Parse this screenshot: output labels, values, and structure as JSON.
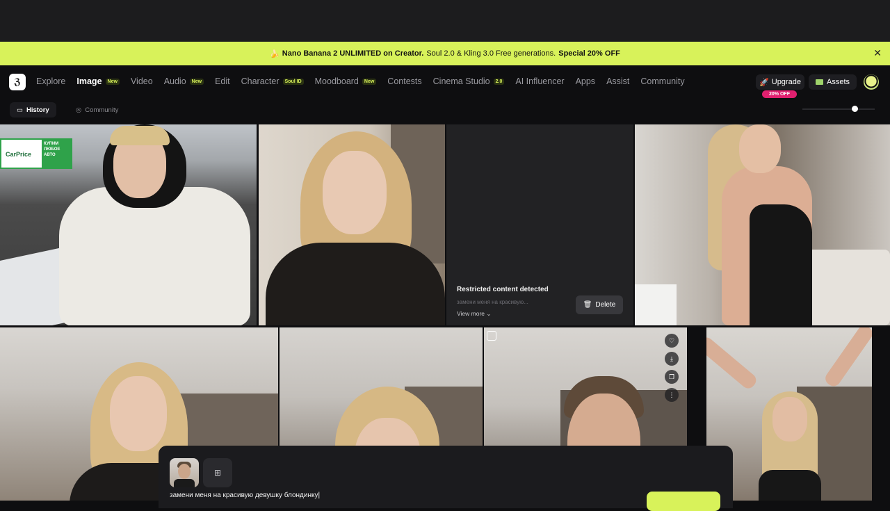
{
  "promo": {
    "emoji": "🍌",
    "bold1": "Nano Banana 2 UNLIMITED on Creator.",
    "text": "Soul 2.0 & Kling 3.0 Free generations.",
    "bold2": "Special 20% OFF",
    "close": "✕"
  },
  "nav": {
    "items": [
      {
        "label": "Explore",
        "badge": ""
      },
      {
        "label": "Image",
        "badge": "New"
      },
      {
        "label": "Video",
        "badge": ""
      },
      {
        "label": "Audio",
        "badge": "New"
      },
      {
        "label": "Edit",
        "badge": ""
      },
      {
        "label": "Character",
        "badge": "Soul ID"
      },
      {
        "label": "Moodboard",
        "badge": "New"
      },
      {
        "label": "Contests",
        "badge": ""
      },
      {
        "label": "Cinema Studio",
        "badge": "2.0"
      },
      {
        "label": "AI Influencer",
        "badge": ""
      },
      {
        "label": "Apps",
        "badge": ""
      },
      {
        "label": "Assist",
        "badge": ""
      },
      {
        "label": "Community",
        "badge": ""
      }
    ],
    "upgrade": "Upgrade",
    "upgrade_badge": "20% OFF",
    "assets": "Assets"
  },
  "subnav": {
    "history": "History",
    "community": "Community"
  },
  "restricted": {
    "title": "Restricted content detected",
    "subtitle": "замени меня на красивую...",
    "view_more": "View more",
    "delete": "Delete"
  },
  "sign": {
    "brand": "CarPrice",
    "text1": "КУПИМ",
    "text2": "ЛЮБОЕ",
    "text3": "АВТО"
  },
  "composer": {
    "prompt": "замени меня на красивую девушку блондинку"
  },
  "colors": {
    "accent": "#d8f25a",
    "offer": "#e0206f"
  }
}
